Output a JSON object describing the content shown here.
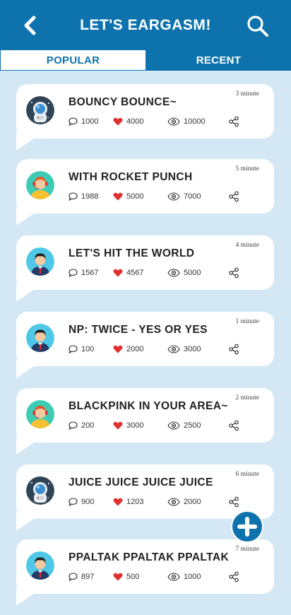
{
  "header": {
    "title": "LET'S EARGASM!"
  },
  "tabs": [
    {
      "label": "POPULAR",
      "active": true
    },
    {
      "label": "RECENT",
      "active": false
    }
  ],
  "colors": {
    "primary": "#0e73ad",
    "background": "#d3e8f4",
    "heart": "#e0312f"
  },
  "posts": [
    {
      "title": "BOUNCY BOUNCE~",
      "time": "3 minute",
      "comments": "1000",
      "likes": "4000",
      "views": "10000",
      "avatar": "astronaut-avatar"
    },
    {
      "title": "WITH ROCKET PUNCH",
      "time": "5 minute",
      "comments": "1988",
      "likes": "5000",
      "views": "7000",
      "avatar": "support-agent-avatar"
    },
    {
      "title": "LET'S HIT THE WORLD",
      "time": "4 minute",
      "comments": "1567",
      "likes": "4567",
      "views": "5000",
      "avatar": "businessman-avatar"
    },
    {
      "title": "NP: TWICE - YES OR YES",
      "time": "1 minute",
      "comments": "100",
      "likes": "2000",
      "views": "3000",
      "avatar": "businessman-avatar"
    },
    {
      "title": "BLACKPINK IN YOUR AREA~",
      "time": "2 minute",
      "comments": "200",
      "likes": "3000",
      "views": "2500",
      "avatar": "support-agent-avatar"
    },
    {
      "title": "JUICE JUICE JUICE JUICE",
      "time": "6 minute",
      "comments": "900",
      "likes": "1203",
      "views": "2000",
      "avatar": "astronaut-avatar"
    },
    {
      "title": "PPALTAK PPALTAK PPALTAK",
      "time": "7 minute",
      "comments": "897",
      "likes": "500",
      "views": "1000",
      "avatar": "businessman-avatar"
    }
  ]
}
